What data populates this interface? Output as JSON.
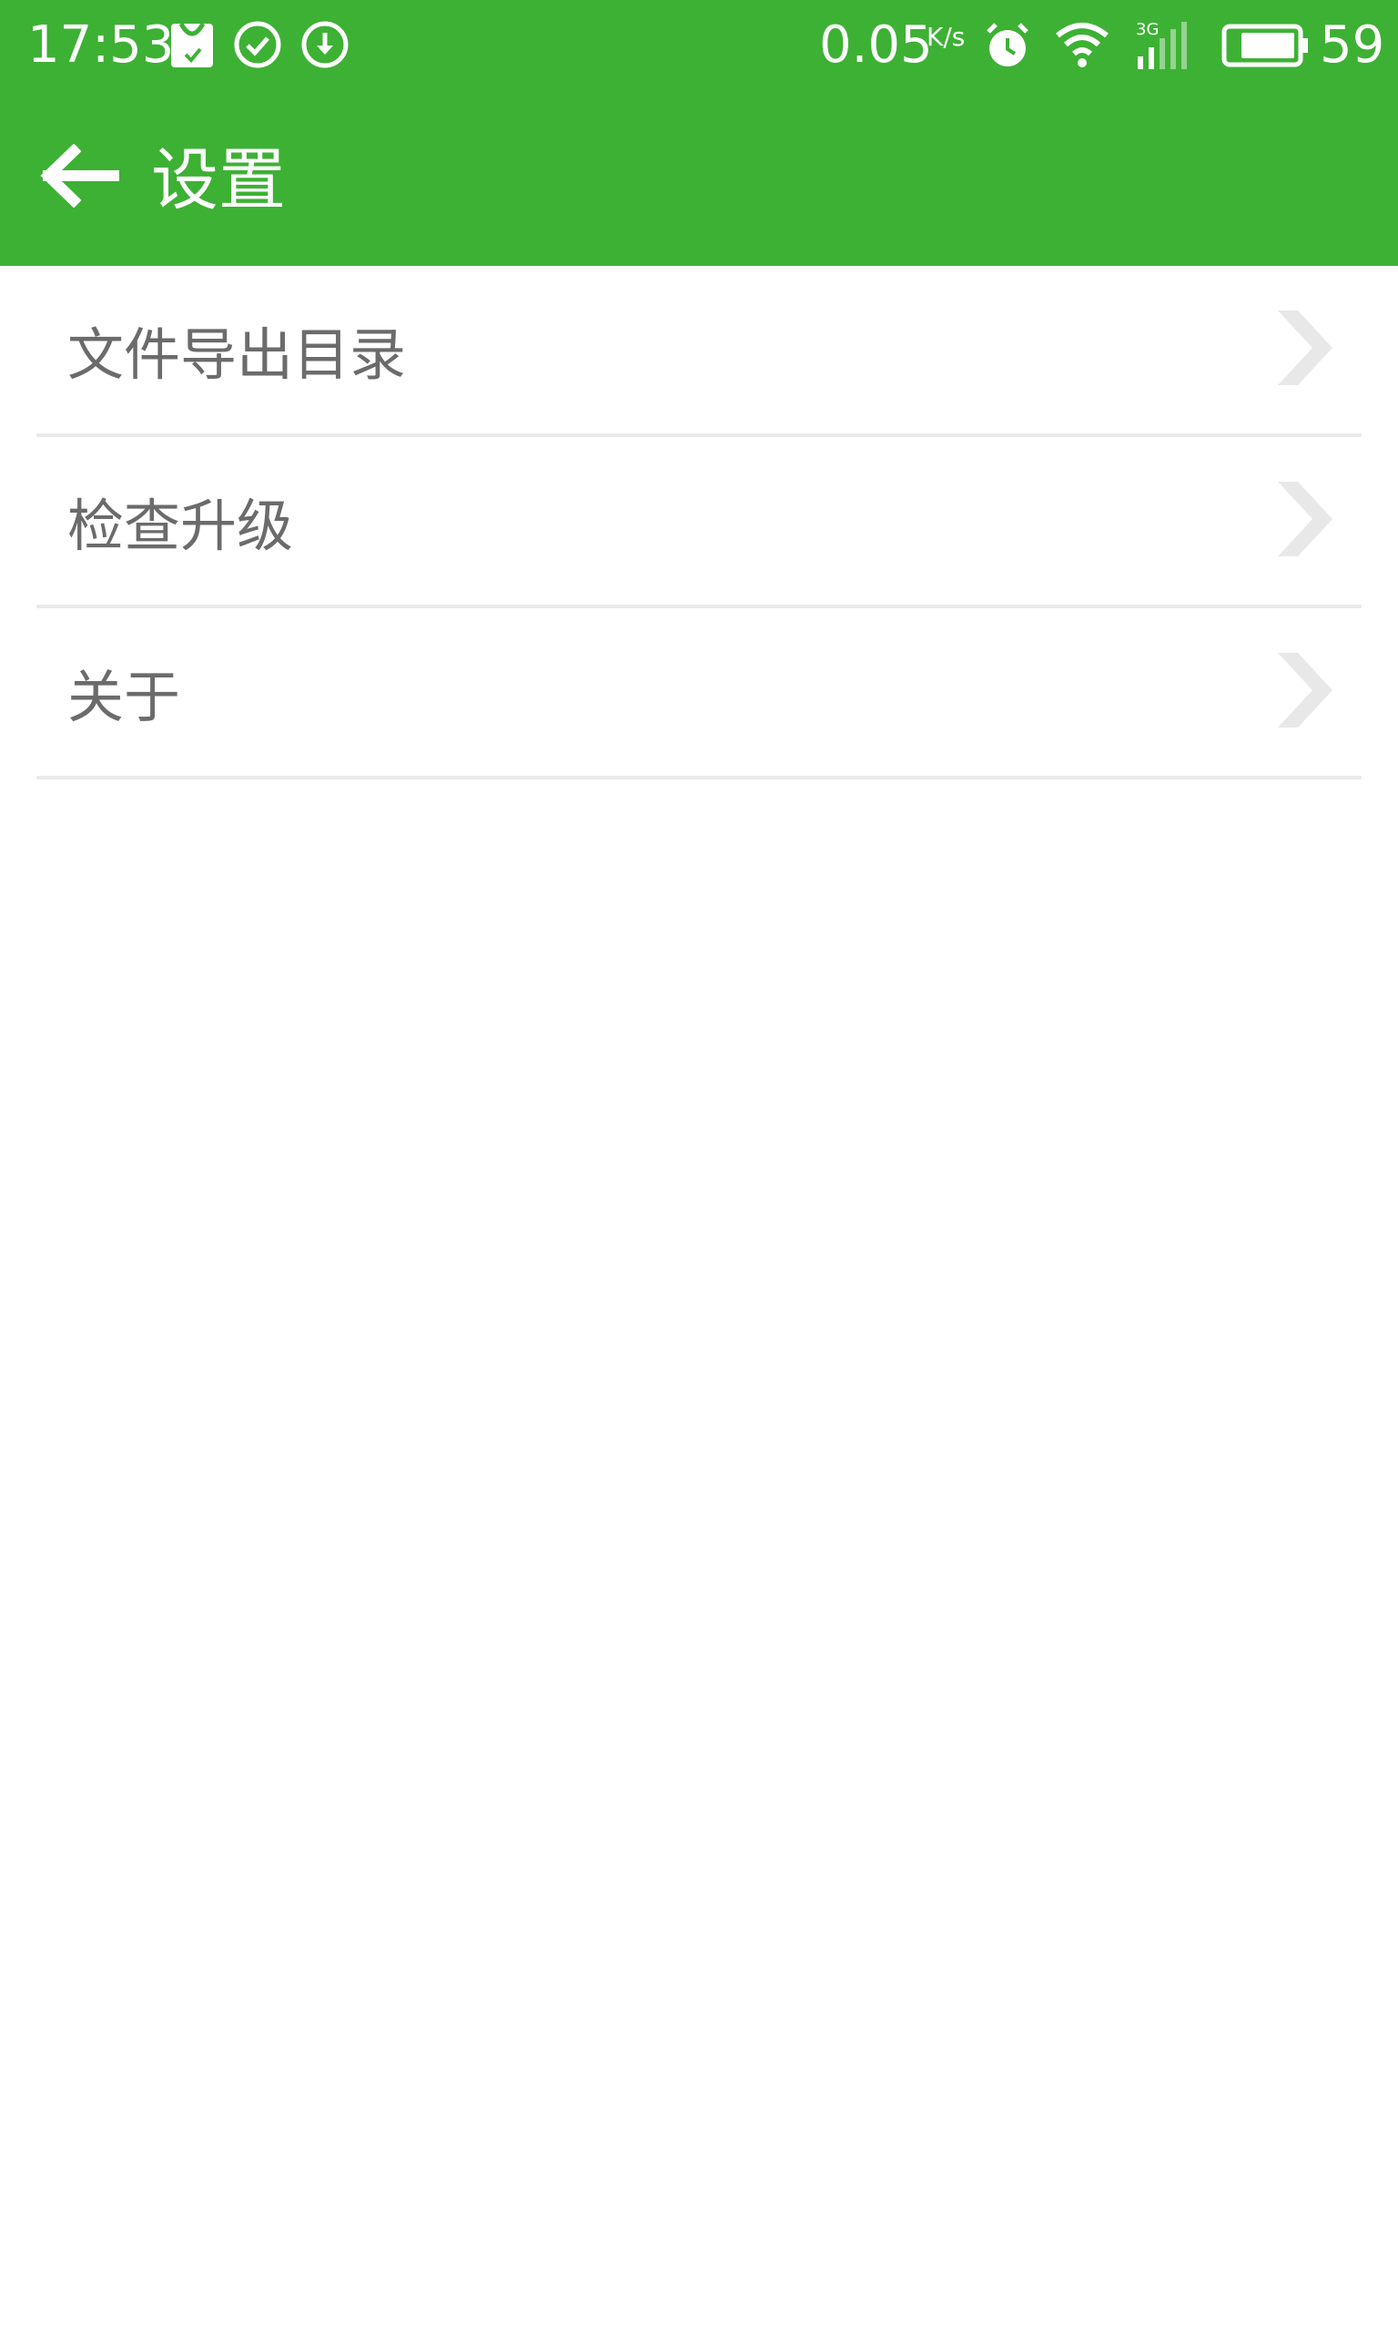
{
  "status_bar": {
    "time": "17:53",
    "net_speed": "0.05",
    "net_unit": "K/s",
    "network_type": "3G",
    "battery_percent": "59",
    "icons": [
      "shopping-bag-icon",
      "check-circle-icon",
      "download-circle-icon",
      "alarm-icon",
      "wifi-icon",
      "signal-icon",
      "battery-icon"
    ]
  },
  "toolbar": {
    "back_icon": "arrow-left-icon",
    "title": "设置",
    "background_color": "#3db134"
  },
  "settings": {
    "items": [
      {
        "label": "文件导出目录",
        "icon": "chevron-right-icon"
      },
      {
        "label": "检查升级",
        "icon": "chevron-right-icon"
      },
      {
        "label": "关于",
        "icon": "chevron-right-icon"
      }
    ]
  }
}
